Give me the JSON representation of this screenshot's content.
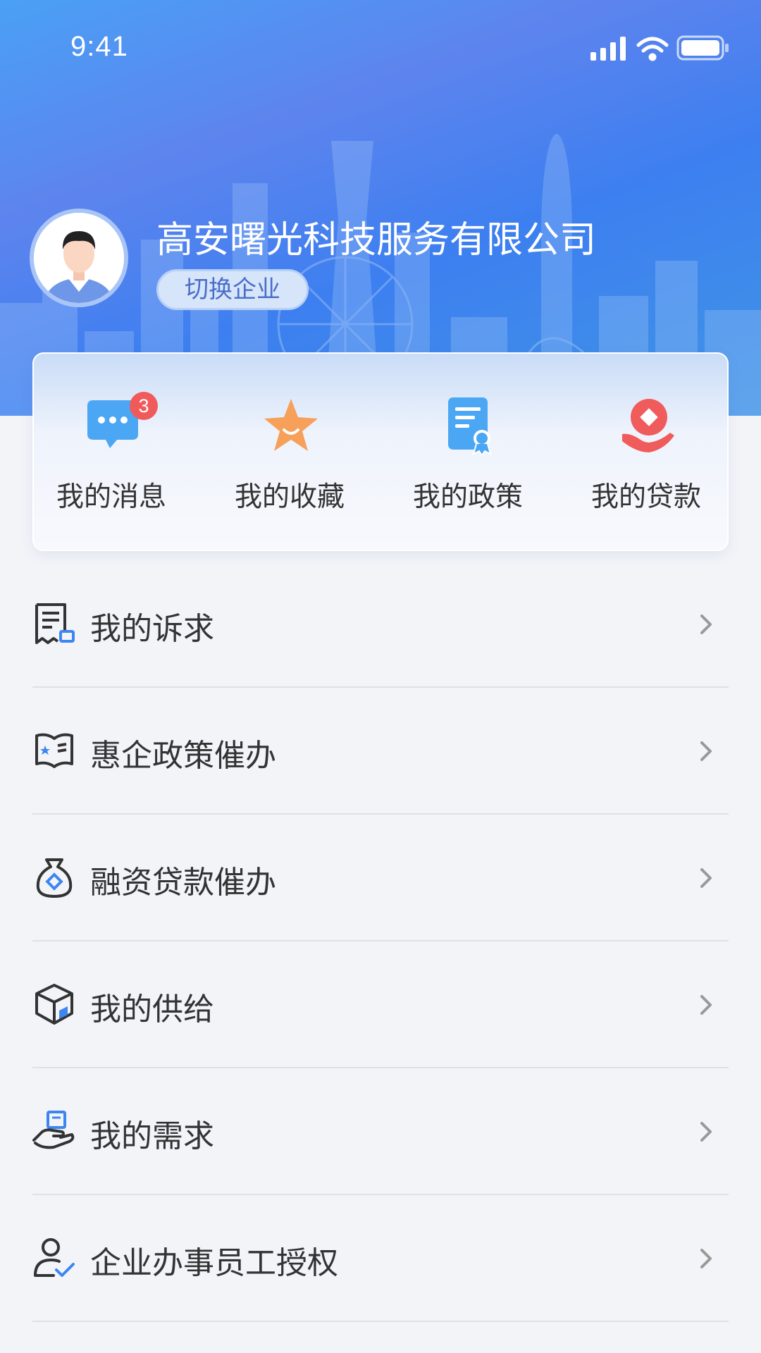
{
  "status_bar": {
    "time": "9:41"
  },
  "profile": {
    "company_name": "高安曙光科技服务有限公司",
    "switch_label": "切换企业"
  },
  "quick_actions": [
    {
      "label": "我的消息",
      "icon": "message-icon",
      "badge": "3"
    },
    {
      "label": "我的收藏",
      "icon": "star-icon"
    },
    {
      "label": "我的政策",
      "icon": "policy-document-icon"
    },
    {
      "label": "我的贷款",
      "icon": "loan-icon"
    }
  ],
  "menu": [
    {
      "label": "我的诉求",
      "icon": "receipt-chat-icon"
    },
    {
      "label": "惠企政策催办",
      "icon": "policy-book-icon"
    },
    {
      "label": "融资贷款催办",
      "icon": "money-bag-icon"
    },
    {
      "label": "我的供给",
      "icon": "box-icon"
    },
    {
      "label": "我的需求",
      "icon": "hand-request-icon"
    },
    {
      "label": "企业办事员工授权",
      "icon": "user-check-icon"
    }
  ],
  "colors": {
    "header_gradient_start": "#4aa0f5",
    "header_gradient_end": "#3d7ff0",
    "badge": "#f15a5a",
    "accent_blue": "#3d86f2",
    "text_dark": "#333333",
    "divider": "#dde1e8",
    "page_bg": "#f2f4f8"
  }
}
